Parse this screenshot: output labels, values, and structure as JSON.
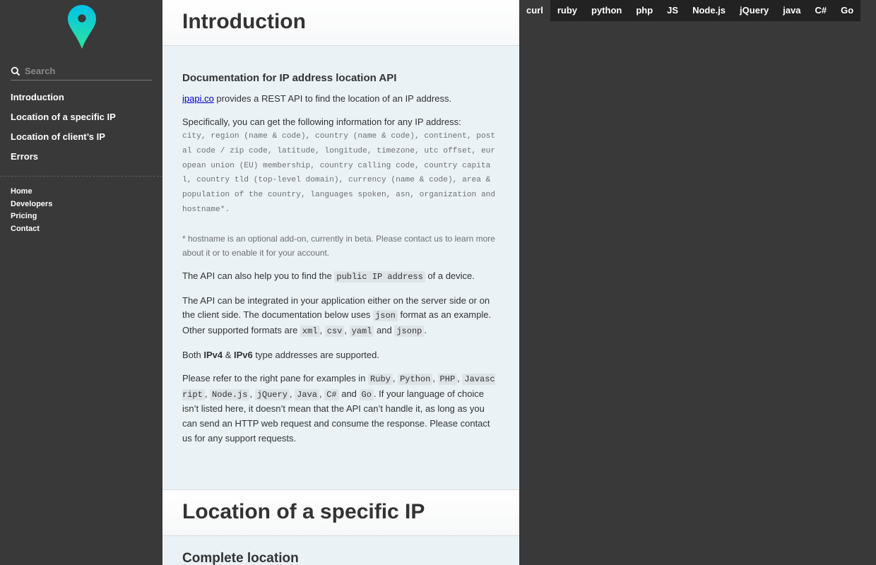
{
  "sidebar": {
    "logo": "map-pin-logo",
    "search_placeholder": "Search",
    "toc": [
      "Introduction",
      "Location of a specific IP",
      "Location of client’s IP",
      "Errors"
    ],
    "footer_links": [
      "Home",
      "Developers",
      "Pricing",
      "Contact"
    ]
  },
  "main": {
    "intro_title": "Introduction",
    "doc_heading": "Documentation for IP address location API",
    "p1_link": "ipapi.co",
    "p1_rest": " provides a REST API to find the location of an IP address.",
    "p2": "Specifically, you can get the following information for any IP address:",
    "fields_list": "city, region (name & code), country (name & code), continent, postal code / zip code, latitude, longitude, timezone, utc offset, european union (EU) membership, country calling code, country capital, country tld (top-level domain), currency (name & code), area & population of the country, languages spoken, asn, organization and hostname*.",
    "note": "* hostname is an optional add-on, currently in beta. Please contact us to learn more about it or to enable it for your account.",
    "p3_pre": "The API can also help you to find the ",
    "p3_code": "public IP address",
    "p3_post": " of a device.",
    "p4_pre": "The API can be integrated in your application either on the server side or on the client side. The documentation below uses ",
    "p4_code_json": "json",
    "p4_mid": " format as an example. Other supported formats are ",
    "p4_code_xml": "xml",
    "p4_code_csv": "csv",
    "p4_code_yaml": "yaml",
    "p4_and": " and ",
    "p4_code_jsonp": "jsonp",
    "p5_pre": "Both ",
    "p5_ipv4": "IPv4",
    "p5_amp": " & ",
    "p5_ipv6": "IPv6",
    "p5_post": " type addresses are supported.",
    "p6_pre": "Please refer to the right pane for examples in ",
    "p6_langs": [
      "Ruby",
      "Python",
      "PHP",
      "Javascript",
      "Node.js",
      "jQuery",
      "Java",
      "C#",
      "Go"
    ],
    "p6_and": " and ",
    "p6_post": ". If your language of choice isn’t listed here, it doesn’t mean that the API can’t handle it, as long as you can send an HTTP web request and consume the response. Please contact us for any support requests.",
    "section2_title": "Location of a specific IP",
    "section2_sub": "Complete location"
  },
  "lang_tabs": {
    "active": "curl",
    "items": [
      "curl",
      "ruby",
      "python",
      "php",
      "JS",
      "Node.js",
      "jQuery",
      "java",
      "C#",
      "Go"
    ]
  },
  "colors": {
    "sidebar_bg": "#393939",
    "content_bg": "#eaf2f6",
    "tabs_bg": "#222222",
    "logo_gradient_top": "#00c2e8",
    "logo_gradient_bottom": "#2ee59d"
  }
}
